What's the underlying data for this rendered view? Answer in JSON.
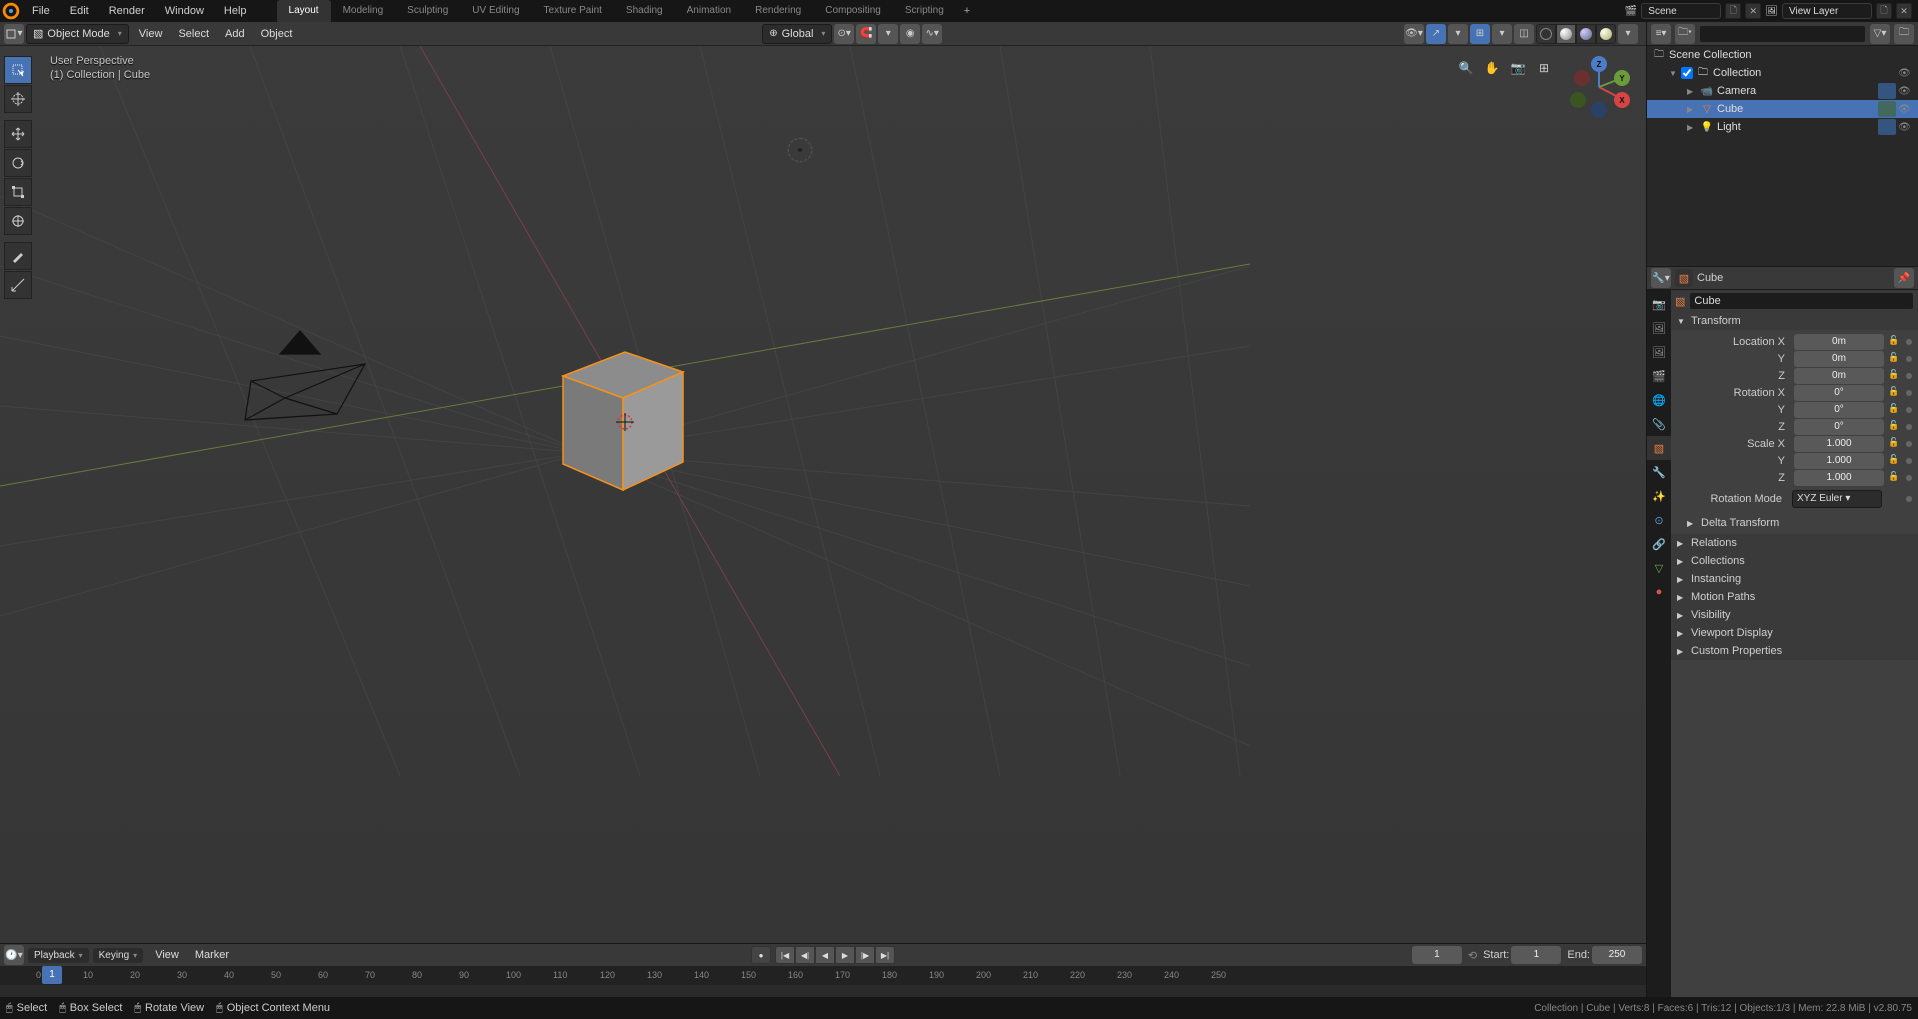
{
  "top_menus": [
    "File",
    "Edit",
    "Render",
    "Window",
    "Help"
  ],
  "workspaces": [
    "Layout",
    "Modeling",
    "Sculpting",
    "UV Editing",
    "Texture Paint",
    "Shading",
    "Animation",
    "Rendering",
    "Compositing",
    "Scripting"
  ],
  "active_workspace": "Layout",
  "scene_name": "Scene",
  "view_layer": "View Layer",
  "viewport": {
    "mode": "Object Mode",
    "menus": [
      "View",
      "Select",
      "Add",
      "Object"
    ],
    "orientation": "Global",
    "overlay_line1": "User Perspective",
    "overlay_line2": "(1) Collection | Cube"
  },
  "outliner": {
    "root": "Scene Collection",
    "collection": "Collection",
    "items": [
      {
        "name": "Camera",
        "icon": "camera"
      },
      {
        "name": "Cube",
        "icon": "mesh",
        "selected": true
      },
      {
        "name": "Light",
        "icon": "light"
      }
    ]
  },
  "properties": {
    "object_name": "Cube",
    "mesh_name": "Cube",
    "transform_label": "Transform",
    "location": {
      "label": "Location",
      "fields": [
        {
          "axis": "X",
          "val": "0m"
        },
        {
          "axis": "Y",
          "val": "0m"
        },
        {
          "axis": "Z",
          "val": "0m"
        }
      ]
    },
    "rotation": {
      "label": "Rotation",
      "fields": [
        {
          "axis": "X",
          "val": "0°"
        },
        {
          "axis": "Y",
          "val": "0°"
        },
        {
          "axis": "Z",
          "val": "0°"
        }
      ]
    },
    "scale": {
      "label": "Scale",
      "fields": [
        {
          "axis": "X",
          "val": "1.000"
        },
        {
          "axis": "Y",
          "val": "1.000"
        },
        {
          "axis": "Z",
          "val": "1.000"
        }
      ]
    },
    "rotation_mode_label": "Rotation Mode",
    "rotation_mode": "XYZ Euler",
    "sections": [
      "Delta Transform",
      "Relations",
      "Collections",
      "Instancing",
      "Motion Paths",
      "Visibility",
      "Viewport Display",
      "Custom Properties"
    ]
  },
  "timeline": {
    "playback": "Playback",
    "keying": "Keying",
    "menus": [
      "View",
      "Marker"
    ],
    "current": "1",
    "start_label": "Start:",
    "start": "1",
    "end_label": "End:",
    "end": "250",
    "current_frame": "1",
    "ticks": [
      "0",
      "10",
      "20",
      "30",
      "40",
      "50",
      "60",
      "70",
      "80",
      "90",
      "100",
      "110",
      "120",
      "130",
      "140",
      "150",
      "160",
      "170",
      "180",
      "190",
      "200",
      "210",
      "220",
      "230",
      "240",
      "250"
    ]
  },
  "status": {
    "select": "Select",
    "box": "Box Select",
    "rotate": "Rotate View",
    "context": "Object Context Menu",
    "info": "Collection | Cube | Verts:8 | Faces:6 | Tris:12 | Objects:1/3 | Mem: 22.8 MiB | v2.80.75"
  }
}
